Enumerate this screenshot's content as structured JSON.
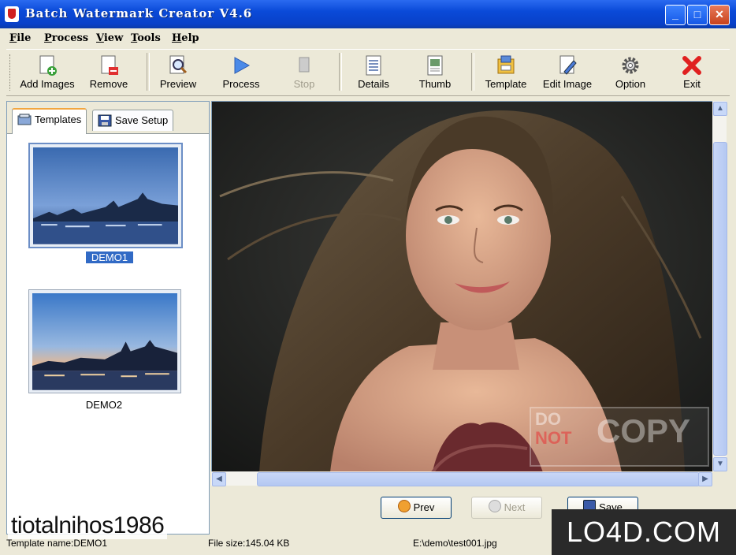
{
  "window": {
    "title": "Batch Watermark Creator V4.6",
    "min_symbol": "_",
    "max_symbol": "□",
    "close_symbol": "✕"
  },
  "menu": [
    {
      "label": "File",
      "u": "F",
      "rest": "ile"
    },
    {
      "label": "Process",
      "u": "P",
      "rest": "rocess"
    },
    {
      "label": "View",
      "u": "V",
      "rest": "iew"
    },
    {
      "label": "Tools",
      "u": "T",
      "rest": "ools"
    },
    {
      "label": "Help",
      "u": "H",
      "rest": "elp"
    }
  ],
  "toolbar": {
    "add_images": "Add Images",
    "remove": "Remove",
    "preview": "Preview",
    "process": "Process",
    "stop": "Stop",
    "details": "Details",
    "thumb": "Thumb",
    "template": "Template",
    "edit_image": "Edit Image",
    "option": "Option",
    "exit": "Exit"
  },
  "tabs": {
    "templates": "Templates",
    "save_setup": "Save Setup"
  },
  "templates": [
    {
      "name": "DEMO1",
      "selected": true
    },
    {
      "name": "DEMO2",
      "selected": false
    }
  ],
  "preview": {
    "watermark_line1": "DO",
    "watermark_line2": "NOT",
    "watermark_word": "COPY"
  },
  "nav": {
    "prev": "Prev",
    "next": "Next",
    "save": "Save"
  },
  "status": {
    "template_name": "Template name:DEMO1",
    "file_size": "File size:145.04 KB",
    "file_path": "E:\\demo\\test001.jpg"
  },
  "overlay": {
    "username": "tiotalnihos1986",
    "site_logo": "LO4D.COM"
  },
  "colors": {
    "titlebar": "#0a4ad8",
    "selection": "#316ac5",
    "viewer_bg": "#1e1f1e",
    "chrome": "#ece9d8"
  }
}
